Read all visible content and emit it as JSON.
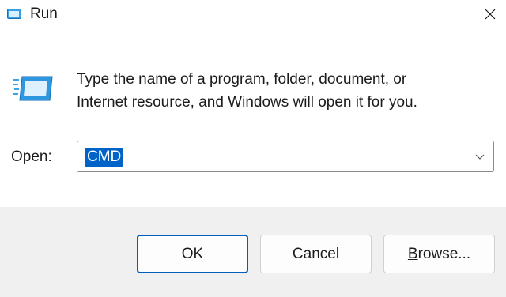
{
  "window": {
    "title": "Run",
    "icon": "run-icon",
    "close_icon": "close-icon"
  },
  "description": {
    "line1": "Type the name of a program, folder, document, or",
    "line2": "Internet resource, and Windows will open it for you."
  },
  "open_field": {
    "label_mnemonic": "O",
    "label_rest": "pen:",
    "value": "CMD",
    "selected": true
  },
  "buttons": {
    "ok": "OK",
    "cancel": "Cancel",
    "browse_mnemonic": "B",
    "browse_rest": "rowse..."
  },
  "colors": {
    "accent": "#005fb8",
    "selection": "#0063c8",
    "footer_bg": "#f0f0f0"
  }
}
